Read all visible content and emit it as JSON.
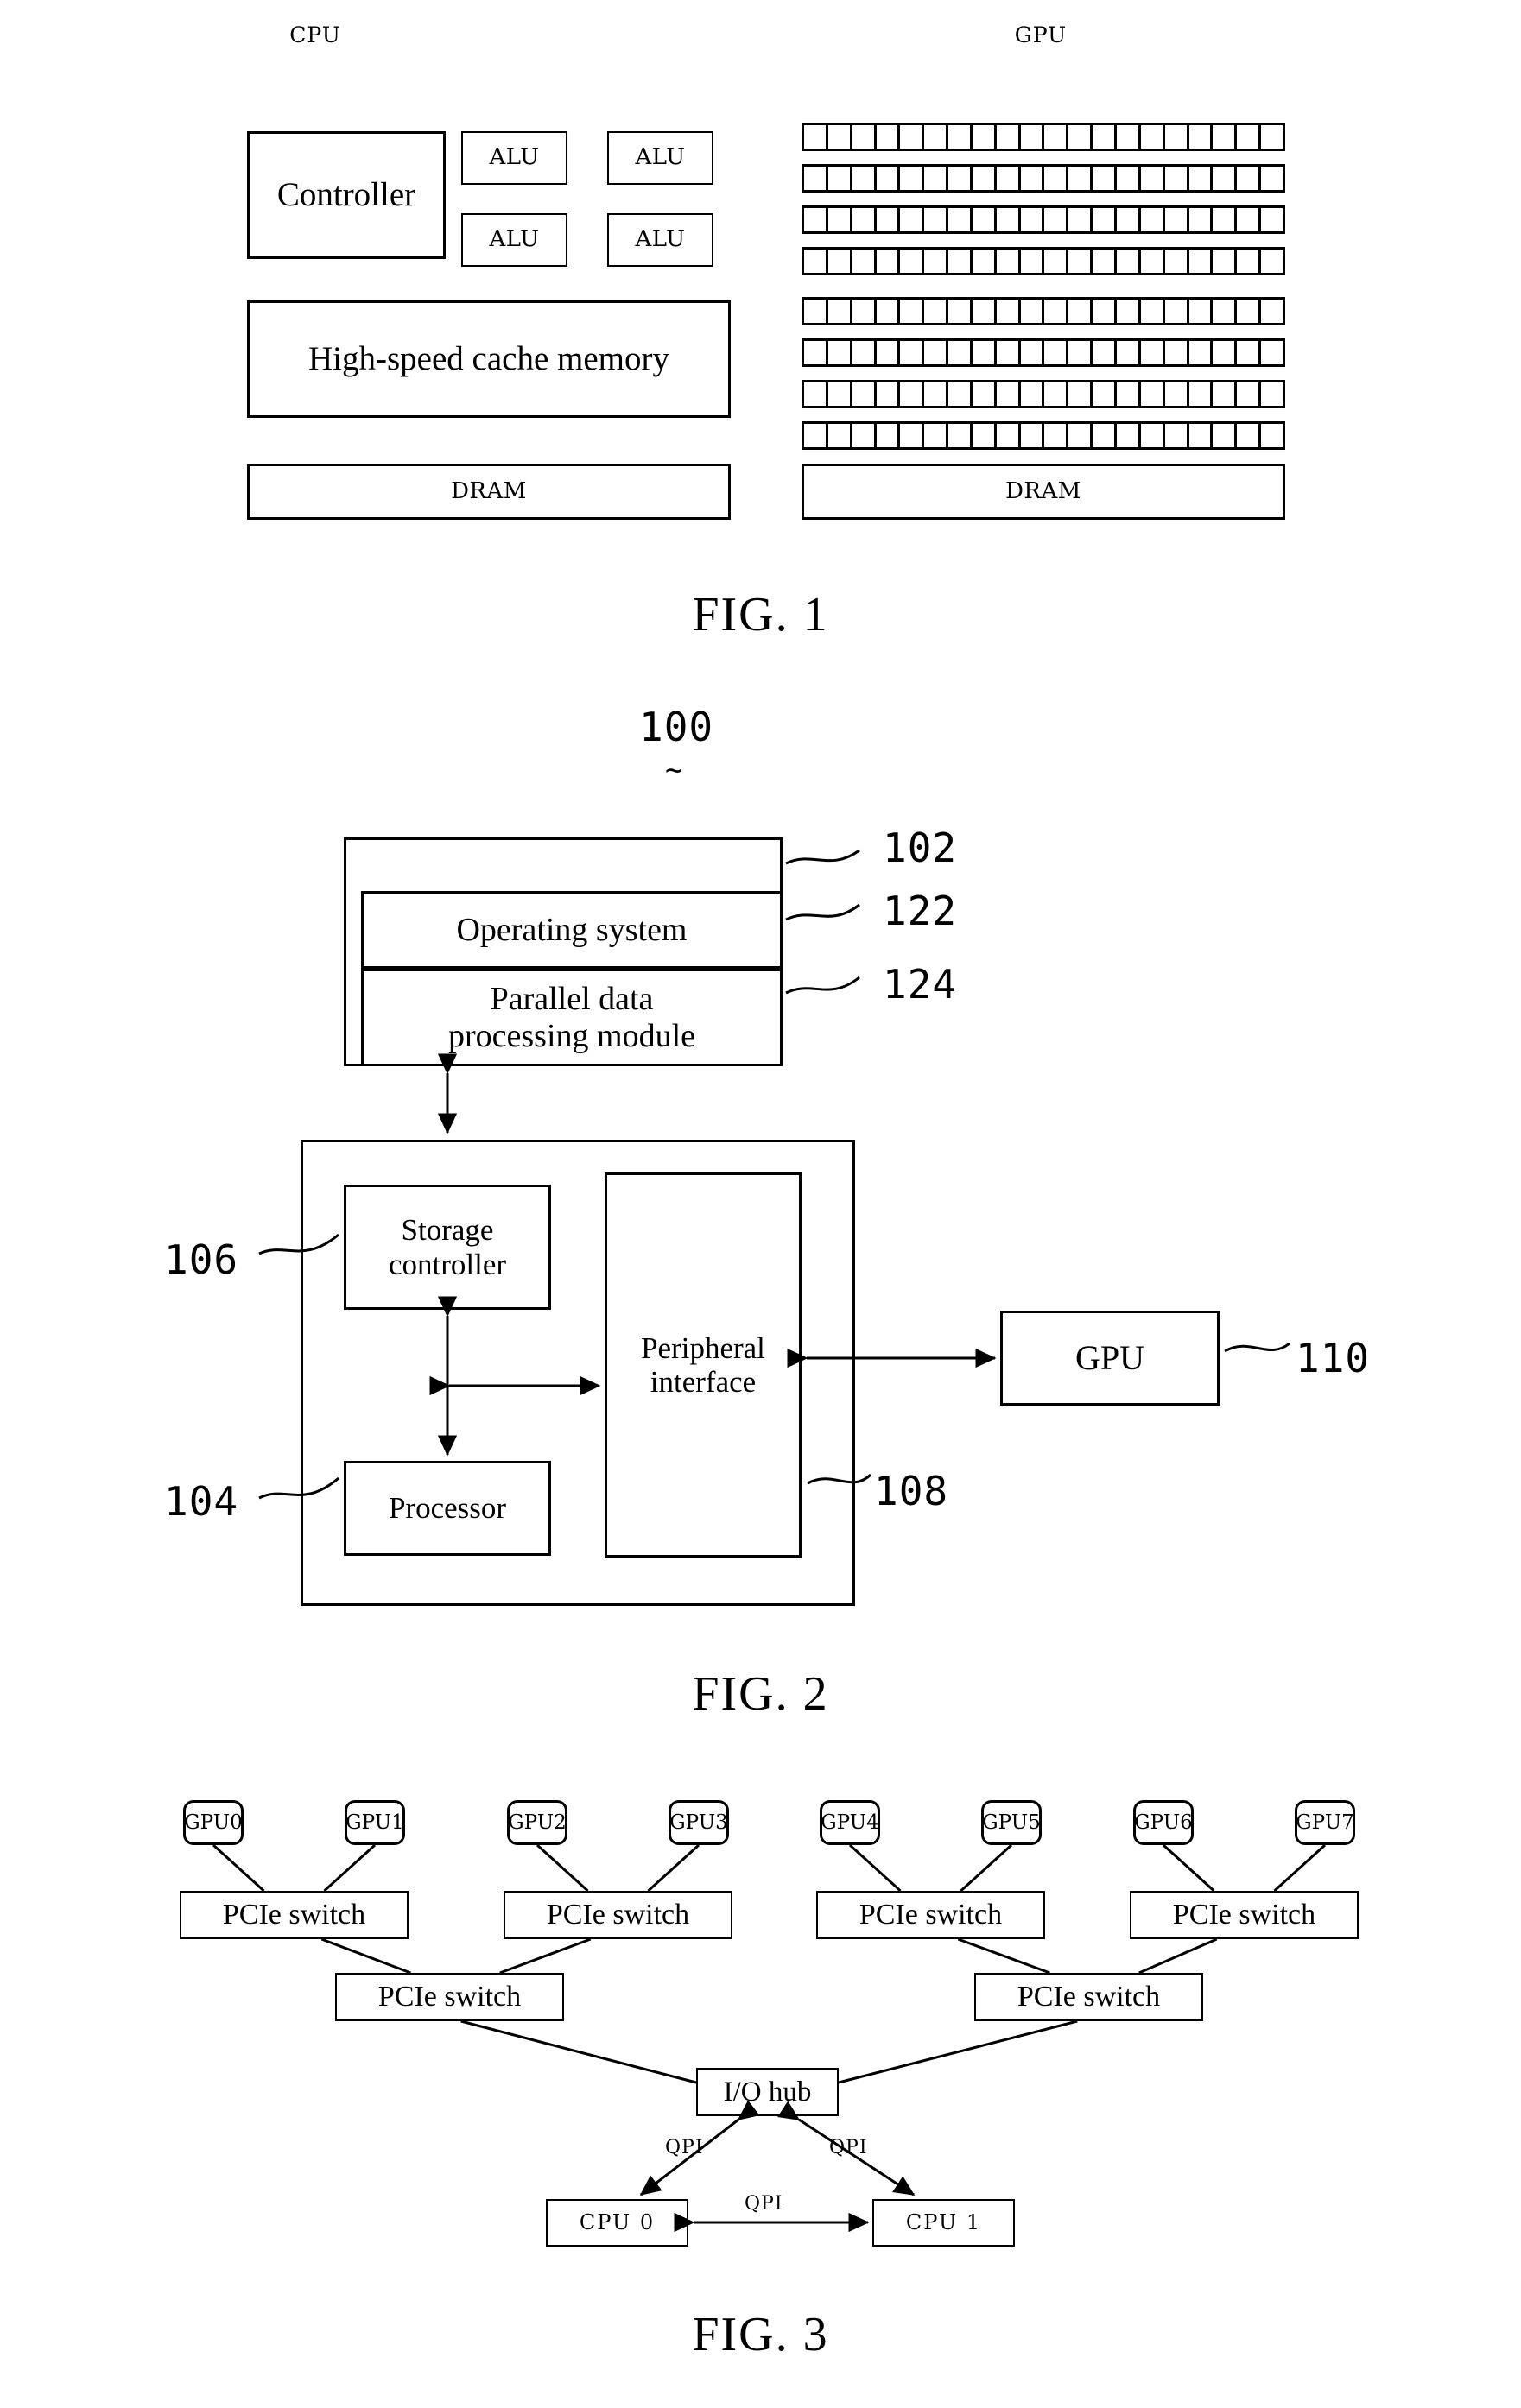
{
  "figures": [
    {
      "id": "fig1",
      "caption": "FIG. 1",
      "cpu": {
        "title": "CPU",
        "controller": "Controller",
        "alus": [
          "ALU",
          "ALU",
          "ALU",
          "ALU"
        ],
        "cache": "High-speed cache memory",
        "dram": "DRAM"
      },
      "gpu": {
        "title": "GPU",
        "dram": "DRAM",
        "core_rows": 8,
        "cores_per_row": 20
      }
    },
    {
      "id": "fig2",
      "caption": "FIG. 2",
      "system_ref": "100",
      "blocks": {
        "memory_ref": "102",
        "operating_system": "Operating system",
        "operating_system_ref": "122",
        "parallel_module_line1": "Parallel data",
        "parallel_module_line2": "processing module",
        "parallel_module_ref": "124",
        "storage_controller_line1": "Storage",
        "storage_controller_line2": "controller",
        "storage_controller_ref": "106",
        "processor": "Processor",
        "processor_ref": "104",
        "peripheral_interface_line1": "Peripheral",
        "peripheral_interface_line2": "interface",
        "peripheral_interface_ref": "108",
        "gpu": "GPU",
        "gpu_ref": "110"
      }
    },
    {
      "id": "fig3",
      "caption": "FIG. 3",
      "gpus": [
        "GPU0",
        "GPU1",
        "GPU2",
        "GPU3",
        "GPU4",
        "GPU5",
        "GPU6",
        "GPU7"
      ],
      "pcie_switch_label": "PCIe switch",
      "pcie_switch_count_tier1": 4,
      "pcie_switch_count_tier2": 2,
      "io_hub": "I/O hub",
      "cpus": [
        "CPU 0",
        "CPU 1"
      ],
      "qpi_labels": [
        "QPI",
        "QPI",
        "QPI"
      ]
    }
  ]
}
